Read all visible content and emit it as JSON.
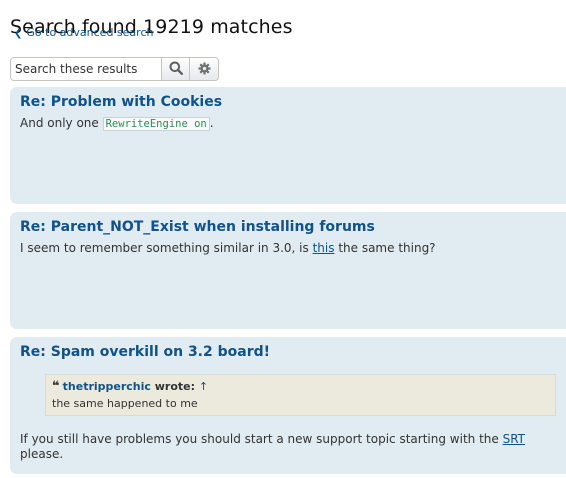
{
  "header": {
    "title": "Search found 19219 matches",
    "back_link": "Go to advanced search"
  },
  "search": {
    "placeholder": "Search these results",
    "search_icon": "search-icon",
    "settings_icon": "gear-icon"
  },
  "posts": [
    {
      "title": "Re: Problem with Cookies",
      "text_before": "And only one",
      "code": "RewriteEngine on",
      "text_after": "."
    },
    {
      "title": "Re: Parent_NOT_Exist when installing forums",
      "text_before": "I seem to remember something similar in 3.0, is",
      "link": "this",
      "text_after": "the same thing?"
    },
    {
      "title": "Re: Spam overkill on 3.2 board!",
      "quote_author": "thetripperchic",
      "quote_wrote": "wrote:",
      "quote_arrow": "↑",
      "quote_body": "the same happened to me",
      "text_before": "If you still have problems you should start a new support topic starting with the",
      "link": "SRT",
      "text_after": "please."
    }
  ],
  "colors": {
    "link": "#105289",
    "post_bg": "#e1ebf2",
    "quote_bg": "#ebeadd"
  }
}
